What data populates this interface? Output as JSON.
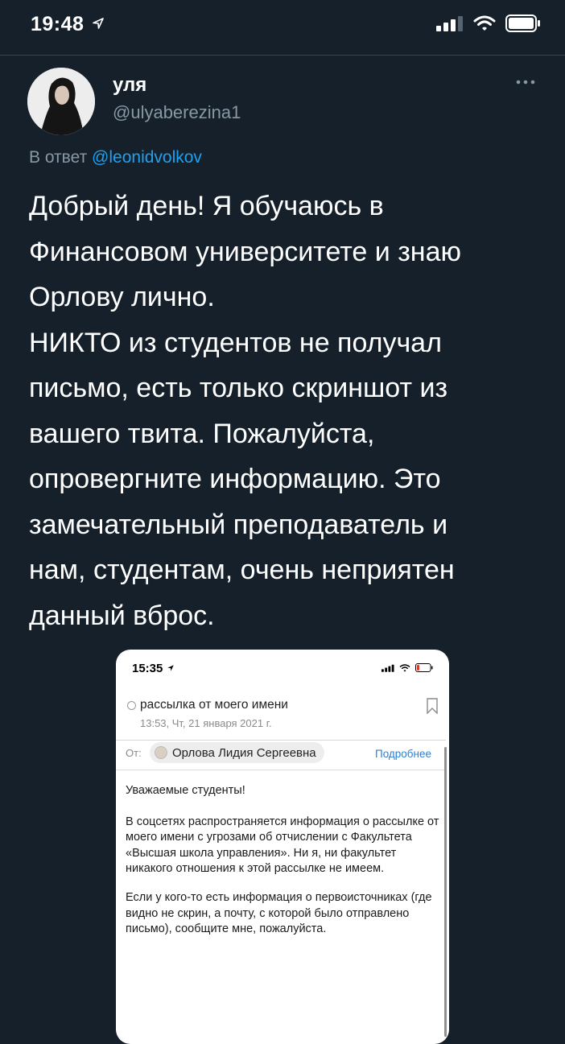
{
  "status_bar": {
    "time": "19:48"
  },
  "tweet": {
    "display_name": "уля",
    "handle": "@ulyaberezina1",
    "reply_prefix": "В ответ",
    "reply_mention": "@leonidvolkov",
    "text": "Добрый день! Я обучаюсь в\nФинансовом университете и знаю\nОрлову лично.\nНИКТО из студентов не получал\nписьмо, есть только скриншот из\nвашего твита. Пожалуйста,\nопровергните информацию. Это\nзамечательный преподаватель и\nнам, студентам, очень неприятен\nданный вброс."
  },
  "attachment": {
    "status_time": "15:35",
    "subject": "рассылка от моего имени",
    "date": "13:53, Чт, 21 января 2021 г.",
    "from_label": "От:",
    "sender": "Орлова Лидия Сергеевна",
    "more_link": "Подробнее",
    "greeting": "Уважаемые студенты!",
    "paragraph_1": "В соцсетях распространяется информация о рассылке от моего имени с угрозами об отчислении с Факультета «Высшая школа управления». Ни я, ни факультет никакого отношения к этой рассылке не имеем.",
    "paragraph_2": "Если у кого-то есть информация о первоисточниках (где видно не скрин, а почту, с которой было отправлено письмо), сообщите мне, пожалуйста."
  },
  "colors": {
    "background": "#15202b",
    "accent": "#1da1f2",
    "secondary_text": "#8899a6",
    "mail_link": "#2a7fd4"
  },
  "icons": [
    "location-arrow-icon",
    "signal-icon",
    "wifi-icon",
    "battery-icon",
    "more-icon",
    "radio-icon",
    "bookmark-icon"
  ]
}
